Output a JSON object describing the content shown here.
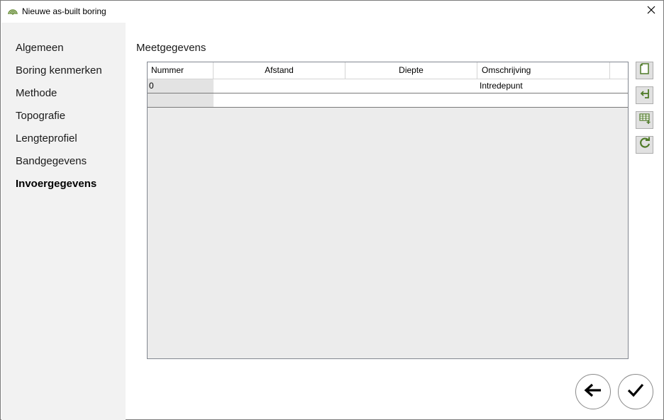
{
  "window": {
    "title": "Nieuwe as-built boring",
    "app_icon": "concentric-arcs-icon",
    "close_icon": "close-icon"
  },
  "sidebar": {
    "items": [
      {
        "label": "Algemeen",
        "active": false
      },
      {
        "label": "Boring kenmerken",
        "active": false
      },
      {
        "label": "Methode",
        "active": false
      },
      {
        "label": "Topografie",
        "active": false
      },
      {
        "label": "Lengteprofiel",
        "active": false
      },
      {
        "label": "Bandgegevens",
        "active": false
      },
      {
        "label": "Invoergegevens",
        "active": true
      }
    ]
  },
  "main": {
    "section_title": "Meetgegevens",
    "grid": {
      "columns": [
        "Nummer",
        "Afstand",
        "Diepte",
        "Omschrijving"
      ],
      "rows": [
        {
          "nummer": "0",
          "afstand": "",
          "diepte": "",
          "omschrijving": "Intredepunt"
        },
        {
          "nummer": "",
          "afstand": "",
          "diepte": "",
          "omschrijving": ""
        }
      ]
    },
    "toolbar": [
      {
        "icon": "new-document-icon"
      },
      {
        "icon": "insert-row-icon"
      },
      {
        "icon": "add-table-row-icon"
      },
      {
        "icon": "refresh-icon"
      }
    ]
  },
  "footer": {
    "back_icon": "arrow-left-icon",
    "confirm_icon": "checkmark-icon"
  },
  "colors": {
    "sidebar_bg": "#f2f2f2",
    "icon_green": "#4f7a28",
    "grid_empty_bg": "#ececec"
  }
}
